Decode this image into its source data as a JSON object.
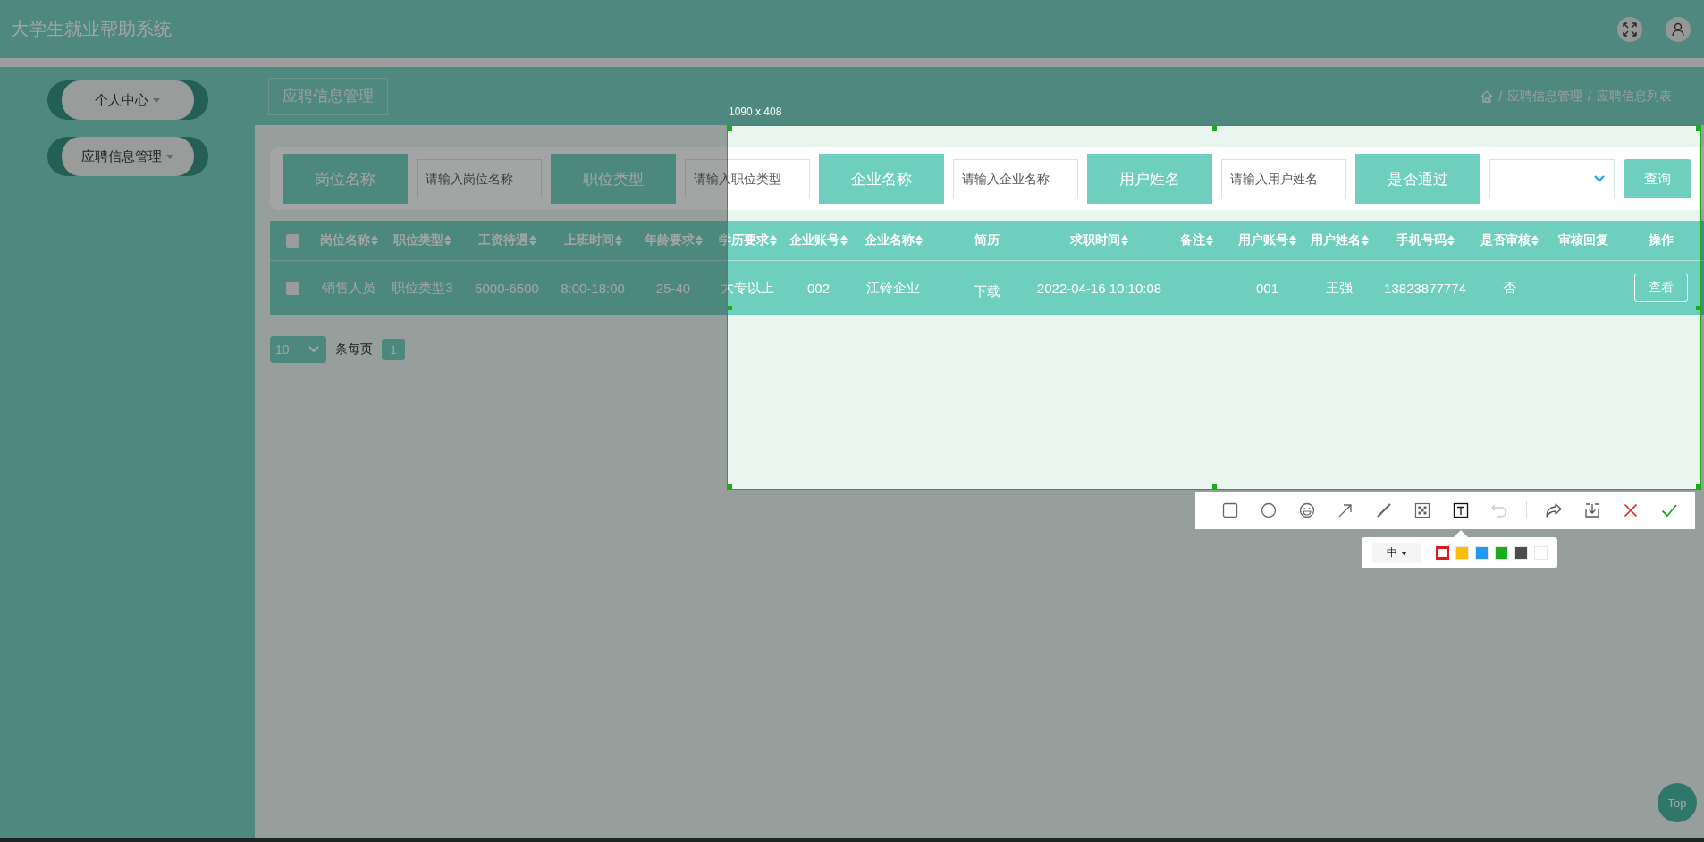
{
  "app": {
    "title": "大学生就业帮助系统"
  },
  "header_buttons": [
    {
      "kind": "fullscreen"
    },
    {
      "kind": "user"
    }
  ],
  "sidebar": {
    "items": [
      {
        "label": "个人中心"
      },
      {
        "label": "应聘信息管理"
      }
    ]
  },
  "tab": {
    "label": "应聘信息管理"
  },
  "breadcrumb": [
    {
      "separator": "/",
      "label": "应聘信息管理"
    },
    {
      "separator": "/",
      "label": "应聘信息列表"
    }
  ],
  "search": {
    "fields": [
      {
        "kind": "input",
        "label": "岗位名称",
        "placeholder": "请输入岗位名称"
      },
      {
        "kind": "input",
        "label": "职位类型",
        "placeholder": "请输入职位类型"
      },
      {
        "kind": "input",
        "label": "企业名称",
        "placeholder": "请输入企业名称"
      },
      {
        "kind": "input",
        "label": "用户姓名",
        "placeholder": "请输入用户姓名"
      },
      {
        "kind": "select",
        "label": "是否通过"
      }
    ],
    "button": "查询"
  },
  "table": {
    "select_all": {
      "checked": false
    },
    "columns": [
      {
        "label": "岗位名称",
        "sortable": true,
        "kind": "text"
      },
      {
        "label": "职位类型",
        "sortable": true,
        "kind": "text"
      },
      {
        "label": "工资待遇",
        "sortable": true,
        "kind": "text"
      },
      {
        "label": "上班时间",
        "sortable": true,
        "kind": "text"
      },
      {
        "label": "年龄要求",
        "sortable": true,
        "kind": "text"
      },
      {
        "label": "学历要求",
        "sortable": true,
        "kind": "text"
      },
      {
        "label": "企业账号",
        "sortable": true,
        "kind": "text"
      },
      {
        "label": "企业名称",
        "sortable": true,
        "kind": "text"
      },
      {
        "label": "简历",
        "sortable": false,
        "kind": "link"
      },
      {
        "label": "求职时间",
        "sortable": true,
        "kind": "text"
      },
      {
        "label": "备注",
        "sortable": true,
        "kind": "text"
      },
      {
        "label": "用户账号",
        "sortable": true,
        "kind": "text"
      },
      {
        "label": "用户姓名",
        "sortable": true,
        "kind": "text"
      },
      {
        "label": "手机号码",
        "sortable": true,
        "kind": "text"
      },
      {
        "label": "是否审核",
        "sortable": true,
        "kind": "text"
      },
      {
        "label": "审核回复",
        "sortable": false,
        "kind": "text"
      },
      {
        "label": "操作",
        "sortable": false,
        "kind": "action"
      }
    ],
    "rows": [
      {
        "checked": false,
        "cells": [
          "销售人员",
          "职位类型3",
          "5000-6500",
          "8:00-18:00",
          "25-40",
          "大专以上",
          "002",
          "江铃企业",
          "下载",
          "2022-04-16 10:10:08",
          null,
          "001",
          "王强",
          "13823877774",
          "否",
          null,
          "查看"
        ]
      }
    ]
  },
  "pagination": {
    "page_size": "10",
    "per_page_label": "条每页",
    "pages": [
      {
        "label": "1",
        "selected": true
      }
    ]
  },
  "back_to_top": "Top",
  "capture": {
    "size_label": "1090 x 408",
    "tools": [
      {
        "kind": "rectangle",
        "selected": false
      },
      {
        "kind": "ellipse",
        "selected": false
      },
      {
        "kind": "emoji",
        "selected": false
      },
      {
        "kind": "arrow",
        "selected": false
      },
      {
        "kind": "pen",
        "selected": false
      },
      {
        "kind": "mosaic",
        "selected": false
      },
      {
        "kind": "text",
        "selected": true
      }
    ],
    "actions": [
      {
        "kind": "undo",
        "disabled": true
      },
      {
        "kind": "redo",
        "disabled": false
      },
      {
        "kind": "download",
        "disabled": false
      },
      {
        "kind": "cancel",
        "disabled": false
      },
      {
        "kind": "confirm",
        "disabled": false
      }
    ],
    "text_size": "中",
    "colors": [
      {
        "color": "#e8141a",
        "selected": true
      },
      {
        "color": "#fbbd08",
        "selected": false
      },
      {
        "color": "#2196f3",
        "selected": false
      },
      {
        "color": "#1aad19",
        "selected": false
      },
      {
        "color": "#4d4d4d",
        "selected": false
      },
      {
        "color": "#ffffff",
        "selected": false
      }
    ]
  }
}
